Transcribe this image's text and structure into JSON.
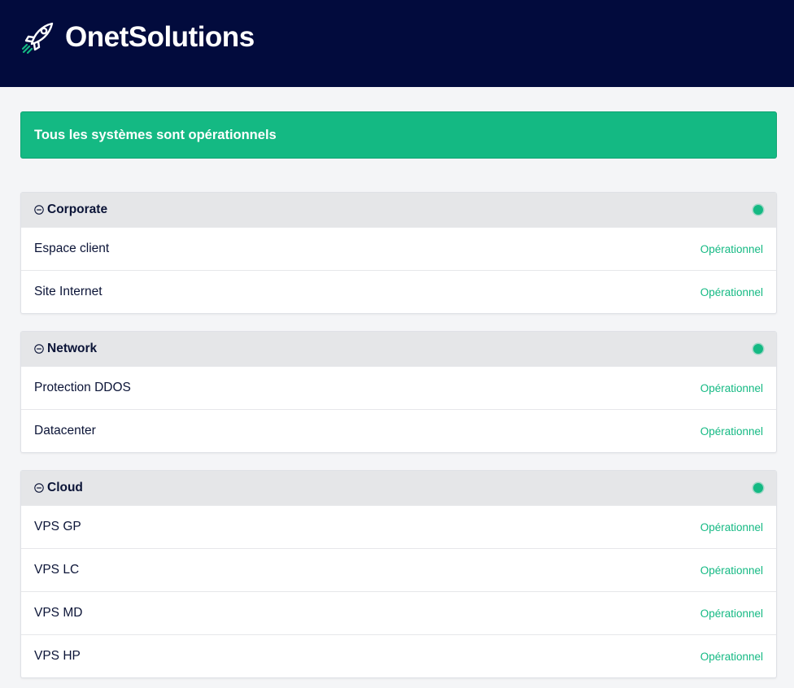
{
  "header": {
    "brand": "OnetSolutions",
    "logo_icon": "rocket-icon"
  },
  "banner": {
    "text": "Tous les systèmes sont opérationnels",
    "color": "#14b983"
  },
  "groups": [
    {
      "title": "Corporate",
      "toggle_icon": "collapse-icon",
      "components": [
        {
          "name": "Espace client",
          "status": "Opérationnel"
        },
        {
          "name": "Site Internet",
          "status": "Opérationnel"
        }
      ]
    },
    {
      "title": "Network",
      "toggle_icon": "collapse-icon",
      "components": [
        {
          "name": "Protection DDOS",
          "status": "Opérationnel"
        },
        {
          "name": "Datacenter",
          "status": "Opérationnel"
        }
      ]
    },
    {
      "title": "Cloud",
      "toggle_icon": "collapse-icon",
      "components": [
        {
          "name": "VPS GP",
          "status": "Opérationnel"
        },
        {
          "name": "VPS LC",
          "status": "Opérationnel"
        },
        {
          "name": "VPS MD",
          "status": "Opérationnel"
        },
        {
          "name": "VPS HP",
          "status": "Opérationnel"
        }
      ]
    }
  ],
  "colors": {
    "header_bg": "#020b3d",
    "operational": "#14b983",
    "text_primary": "#0b1437"
  }
}
